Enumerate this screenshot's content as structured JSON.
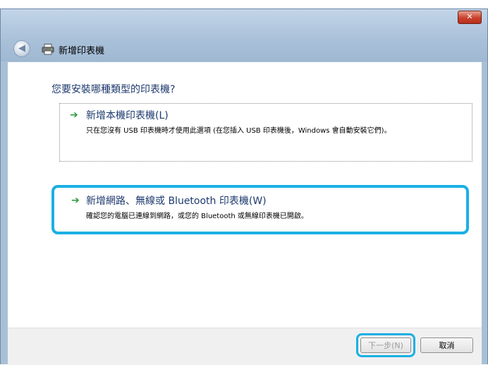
{
  "window": {
    "close_label": "✕"
  },
  "header": {
    "back_glyph": "◀",
    "title": "新增印表機"
  },
  "main": {
    "question": "您要安裝哪種類型的印表機?",
    "options": [
      {
        "title": "新增本機印表機(L)",
        "description": "只在您沒有 USB 印表機時才使用此選項 (在您插入 USB 印表機後，Windows 會自動安裝它們)。"
      },
      {
        "title": "新增網路、無線或 Bluetooth 印表機(W)",
        "description": "確認您的電腦已連線到網路，或您的 Bluetooth 或無線印表機已開啟。"
      }
    ],
    "arrow_glyph": "➔"
  },
  "footer": {
    "next_label": "下一步(N)",
    "cancel_label": "取消"
  },
  "colors": {
    "highlight": "#1ab0e4",
    "link_text": "#1e3a6e",
    "arrow": "#2f9a3c"
  }
}
